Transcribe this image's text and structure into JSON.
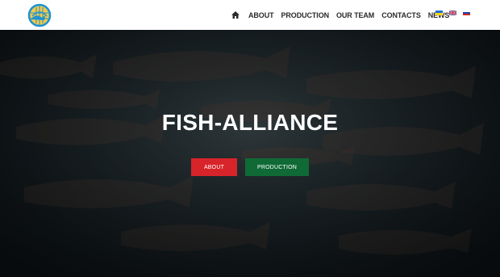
{
  "header": {
    "logo_name": "fish-alliance-globe-logo",
    "home_icon": "home-icon",
    "nav": [
      {
        "label": "ABOUT"
      },
      {
        "label": "PRODUCTION"
      },
      {
        "label": "OUR TEAM"
      },
      {
        "label": "CONTACTS"
      },
      {
        "label": "NEWS"
      }
    ],
    "languages": [
      "ukrainian-flag-icon",
      "english-flag-icon",
      "russian-flag-icon"
    ]
  },
  "hero": {
    "title": "FISH-ALLIANCE",
    "about_button": "ABOUT",
    "production_button": "PRODUCTION"
  },
  "colors": {
    "about_button": "#d7242a",
    "production_button": "#0f6a35",
    "logo_blue": "#1d93d2",
    "logo_yellow": "#f2c94c"
  }
}
